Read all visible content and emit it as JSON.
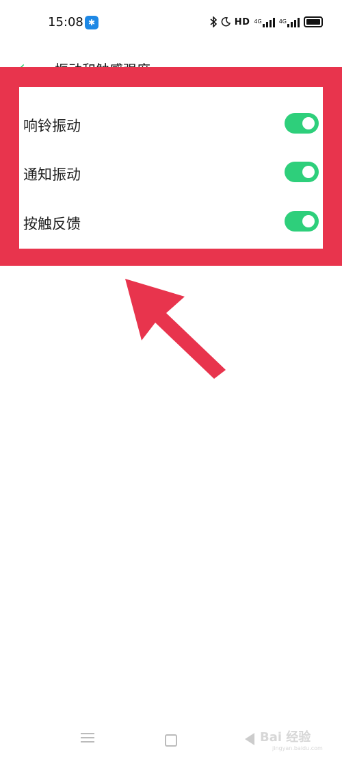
{
  "status_bar": {
    "time": "15:08",
    "bt_badge": "✱",
    "hd_label": "HD",
    "net1": "4G",
    "net2": "4G"
  },
  "header": {
    "back_icon": "‹",
    "title": "振动和触感强度"
  },
  "settings": {
    "rows": [
      {
        "label": "响铃振动",
        "enabled": true
      },
      {
        "label": "通知振动",
        "enabled": true
      },
      {
        "label": "按触反馈",
        "enabled": true
      }
    ]
  },
  "colors": {
    "highlight": "#e8344d",
    "toggle_on": "#2ecf7b"
  },
  "watermark": {
    "text": "Bai 经验",
    "sub": "jingyan.baidu.com"
  }
}
